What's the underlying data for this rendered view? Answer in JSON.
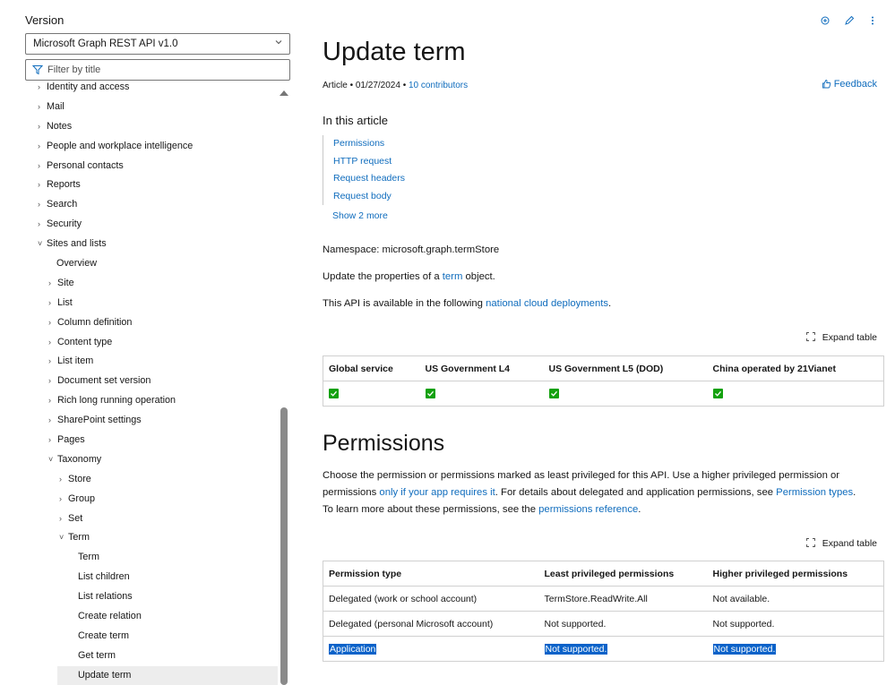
{
  "sidebar": {
    "version_label": "Version",
    "version_selected": "Microsoft Graph REST API v1.0",
    "filter_placeholder": "Filter by title",
    "nav_items": [
      {
        "label": "Identity and access",
        "indent": 0,
        "caret": "right",
        "selected": false
      },
      {
        "label": "Mail",
        "indent": 0,
        "caret": "right",
        "selected": false
      },
      {
        "label": "Notes",
        "indent": 0,
        "caret": "right",
        "selected": false
      },
      {
        "label": "People and workplace intelligence",
        "indent": 0,
        "caret": "right",
        "selected": false
      },
      {
        "label": "Personal contacts",
        "indent": 0,
        "caret": "right",
        "selected": false
      },
      {
        "label": "Reports",
        "indent": 0,
        "caret": "right",
        "selected": false
      },
      {
        "label": "Search",
        "indent": 0,
        "caret": "right",
        "selected": false
      },
      {
        "label": "Security",
        "indent": 0,
        "caret": "right",
        "selected": false
      },
      {
        "label": "Sites and lists",
        "indent": 0,
        "caret": "down",
        "selected": false
      },
      {
        "label": "Overview",
        "indent": 1,
        "caret": "none",
        "selected": false
      },
      {
        "label": "Site",
        "indent": 1,
        "caret": "right",
        "selected": false
      },
      {
        "label": "List",
        "indent": 1,
        "caret": "right",
        "selected": false
      },
      {
        "label": "Column definition",
        "indent": 1,
        "caret": "right",
        "selected": false
      },
      {
        "label": "Content type",
        "indent": 1,
        "caret": "right",
        "selected": false
      },
      {
        "label": "List item",
        "indent": 1,
        "caret": "right",
        "selected": false
      },
      {
        "label": "Document set version",
        "indent": 1,
        "caret": "right",
        "selected": false
      },
      {
        "label": "Rich long running operation",
        "indent": 1,
        "caret": "right",
        "selected": false
      },
      {
        "label": "SharePoint settings",
        "indent": 1,
        "caret": "right",
        "selected": false
      },
      {
        "label": "Pages",
        "indent": 1,
        "caret": "right",
        "selected": false
      },
      {
        "label": "Taxonomy",
        "indent": 1,
        "caret": "down",
        "selected": false
      },
      {
        "label": "Store",
        "indent": 2,
        "caret": "right",
        "selected": false
      },
      {
        "label": "Group",
        "indent": 2,
        "caret": "right",
        "selected": false
      },
      {
        "label": "Set",
        "indent": 2,
        "caret": "right",
        "selected": false
      },
      {
        "label": "Term",
        "indent": 2,
        "caret": "down",
        "selected": false
      },
      {
        "label": "Term",
        "indent": 3,
        "caret": "none",
        "selected": false
      },
      {
        "label": "List children",
        "indent": 3,
        "caret": "none",
        "selected": false
      },
      {
        "label": "List relations",
        "indent": 3,
        "caret": "none",
        "selected": false
      },
      {
        "label": "Create relation",
        "indent": 3,
        "caret": "none",
        "selected": false
      },
      {
        "label": "Create term",
        "indent": 3,
        "caret": "none",
        "selected": false
      },
      {
        "label": "Get term",
        "indent": 3,
        "caret": "none",
        "selected": false
      },
      {
        "label": "Update term",
        "indent": 3,
        "caret": "none",
        "selected": true
      }
    ]
  },
  "header": {
    "title": "Update term",
    "meta_article": "Article",
    "meta_date": "01/27/2024",
    "meta_contributors": "10 contributors",
    "feedback": "Feedback"
  },
  "toc": {
    "heading": "In this article",
    "items": [
      "Permissions",
      "HTTP request",
      "Request headers",
      "Request body"
    ],
    "show_more": "Show 2 more"
  },
  "body": {
    "namespace": "Namespace: microsoft.graph.termStore",
    "update_pre": "Update the properties of a ",
    "update_link": "term",
    "update_post": " object.",
    "avail_pre": "This API is available in the following ",
    "avail_link": "national cloud deployments",
    "avail_post": ".",
    "expand_table": "Expand table"
  },
  "cloud_table": {
    "headers": [
      "Global service",
      "US Government L4",
      "US Government L5 (DOD)",
      "China operated by 21Vianet"
    ],
    "check_color": "#13a10e"
  },
  "permissions": {
    "heading": "Permissions",
    "p1": "Choose the permission or permissions marked as least privileged for this API. Use a higher privileged permission or",
    "p2_pre": "permissions ",
    "p2_link1": "only if your app requires it",
    "p2_mid": ". For details about delegated and application permissions, see ",
    "p2_link2": "Permission types",
    "p2_post": ".",
    "p3_pre": "To learn more about these permissions, see the ",
    "p3_link": "permissions reference",
    "p3_post": ".",
    "expand_table": "Expand table",
    "headers": [
      "Permission type",
      "Least privileged permissions",
      "Higher privileged permissions"
    ],
    "rows": [
      [
        "Delegated (work or school account)",
        "TermStore.ReadWrite.All",
        "Not available."
      ],
      [
        "Delegated (personal Microsoft account)",
        "Not supported.",
        "Not supported."
      ],
      [
        "Application",
        "Not supported.",
        "Not supported."
      ]
    ]
  },
  "colors": {
    "link": "#0f6cbd",
    "selection": "#0a62c9",
    "selected_nav_bg": "#ededed"
  }
}
